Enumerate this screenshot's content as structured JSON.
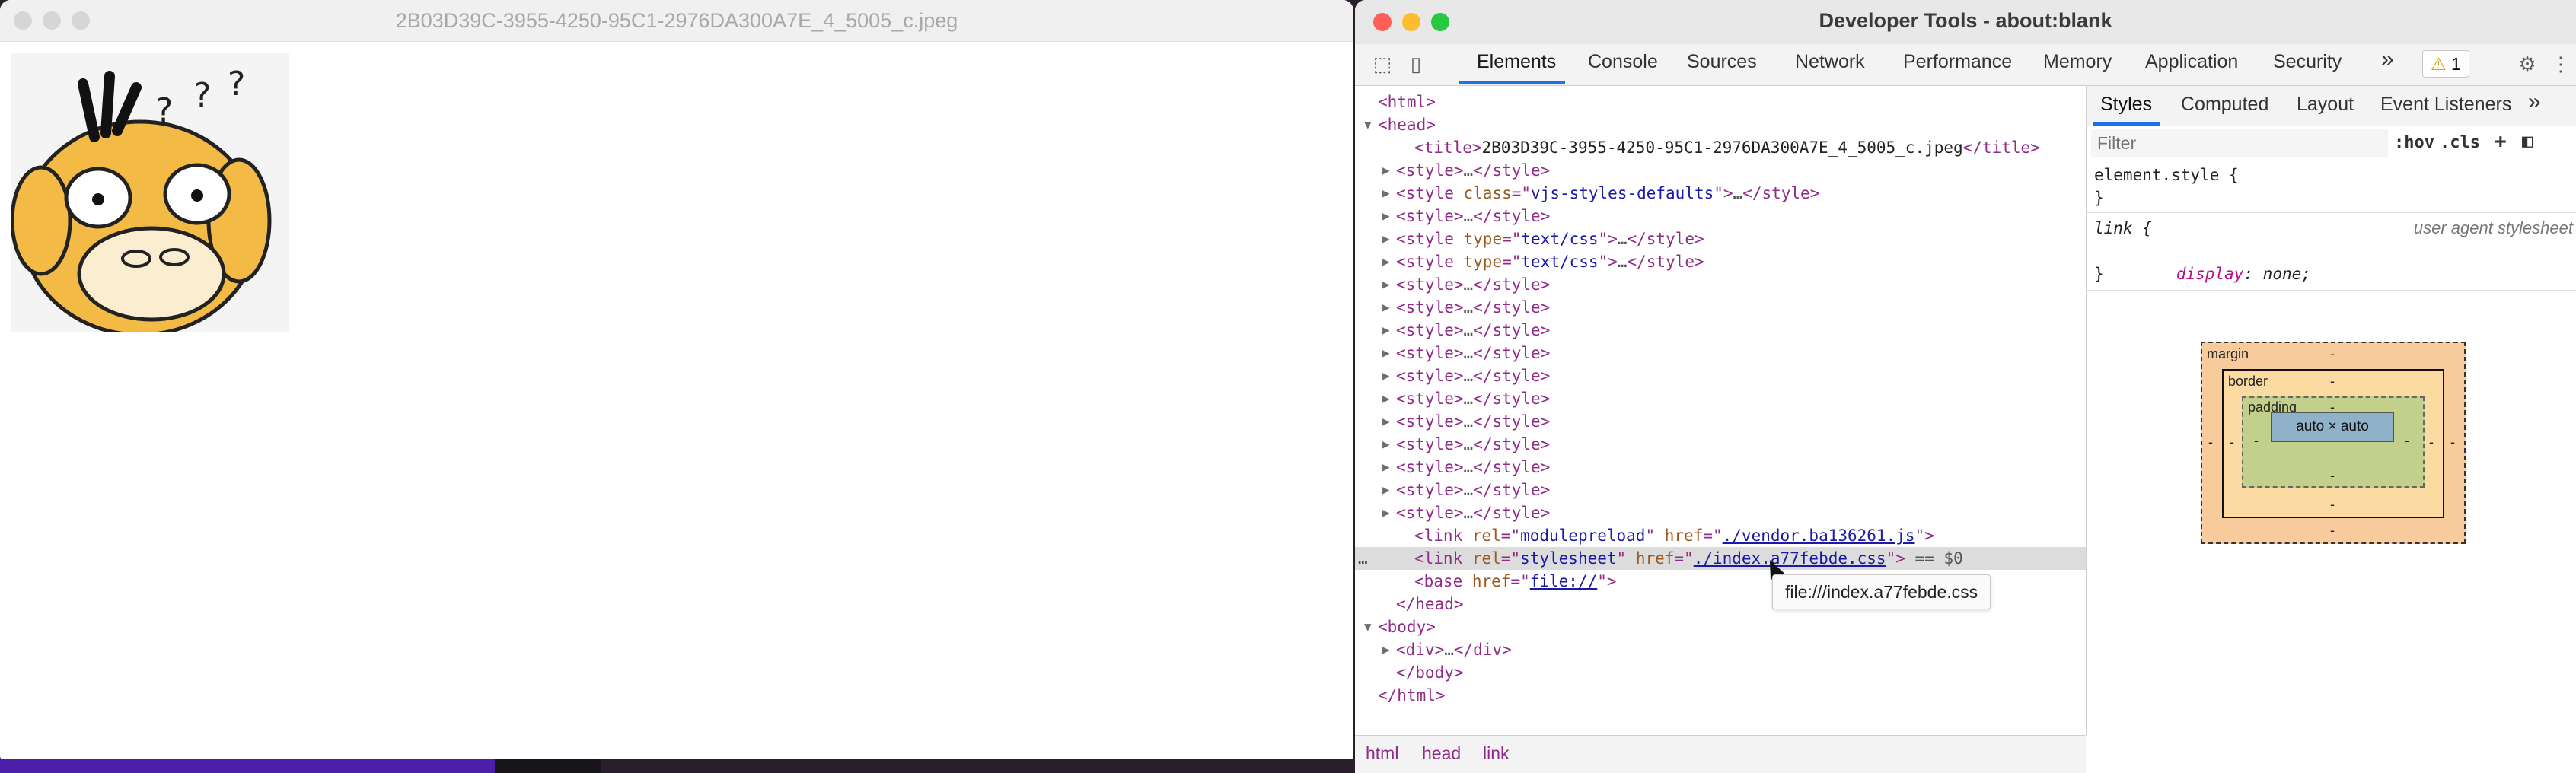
{
  "image_window": {
    "title": "2B03D39C-3955-4250-95C1-2976DA300A7E_4_5005_c.jpeg"
  },
  "devtools": {
    "window_title": "Developer Tools - about:blank",
    "tabs": [
      "Elements",
      "Console",
      "Sources",
      "Network",
      "Performance",
      "Memory",
      "Application",
      "Security"
    ],
    "more_tabs": "»",
    "warning_count": "1",
    "dom": {
      "lines": [
        {
          "indent": 0,
          "tri": "",
          "parts": [
            [
              "tag",
              "<html>"
            ]
          ]
        },
        {
          "indent": 0,
          "tri": "▼",
          "parts": [
            [
              "tag",
              "<head>"
            ]
          ]
        },
        {
          "indent": 2,
          "tri": "",
          "parts": [
            [
              "tag",
              "<title>"
            ],
            [
              "txt",
              "2B03D39C-3955-4250-95C1-2976DA300A7E_4_5005_c.jpeg"
            ],
            [
              "tag",
              "</title>"
            ]
          ]
        },
        {
          "indent": 1,
          "tri": "▶",
          "parts": [
            [
              "tag",
              "<style>"
            ],
            [
              "ell",
              "…"
            ],
            [
              "tag",
              "</style>"
            ]
          ]
        },
        {
          "indent": 1,
          "tri": "▶",
          "parts": [
            [
              "tag",
              "<style "
            ],
            [
              "attr",
              "class"
            ],
            [
              "tag",
              "=\""
            ],
            [
              "val",
              "vjs-styles-defaults"
            ],
            [
              "tag",
              "\">"
            ],
            [
              "ell",
              "…"
            ],
            [
              "tag",
              "</style>"
            ]
          ]
        },
        {
          "indent": 1,
          "tri": "▶",
          "parts": [
            [
              "tag",
              "<style>"
            ],
            [
              "ell",
              "…"
            ],
            [
              "tag",
              "</style>"
            ]
          ]
        },
        {
          "indent": 1,
          "tri": "▶",
          "parts": [
            [
              "tag",
              "<style "
            ],
            [
              "attr",
              "type"
            ],
            [
              "tag",
              "=\""
            ],
            [
              "val",
              "text/css"
            ],
            [
              "tag",
              "\">"
            ],
            [
              "ell",
              "…"
            ],
            [
              "tag",
              "</style>"
            ]
          ]
        },
        {
          "indent": 1,
          "tri": "▶",
          "parts": [
            [
              "tag",
              "<style "
            ],
            [
              "attr",
              "type"
            ],
            [
              "tag",
              "=\""
            ],
            [
              "val",
              "text/css"
            ],
            [
              "tag",
              "\">"
            ],
            [
              "ell",
              "…"
            ],
            [
              "tag",
              "</style>"
            ]
          ]
        },
        {
          "indent": 1,
          "tri": "▶",
          "parts": [
            [
              "tag",
              "<style>"
            ],
            [
              "ell",
              "…"
            ],
            [
              "tag",
              "</style>"
            ]
          ]
        },
        {
          "indent": 1,
          "tri": "▶",
          "parts": [
            [
              "tag",
              "<style>"
            ],
            [
              "ell",
              "…"
            ],
            [
              "tag",
              "</style>"
            ]
          ]
        },
        {
          "indent": 1,
          "tri": "▶",
          "parts": [
            [
              "tag",
              "<style>"
            ],
            [
              "ell",
              "…"
            ],
            [
              "tag",
              "</style>"
            ]
          ]
        },
        {
          "indent": 1,
          "tri": "▶",
          "parts": [
            [
              "tag",
              "<style>"
            ],
            [
              "ell",
              "…"
            ],
            [
              "tag",
              "</style>"
            ]
          ]
        },
        {
          "indent": 1,
          "tri": "▶",
          "parts": [
            [
              "tag",
              "<style>"
            ],
            [
              "ell",
              "…"
            ],
            [
              "tag",
              "</style>"
            ]
          ]
        },
        {
          "indent": 1,
          "tri": "▶",
          "parts": [
            [
              "tag",
              "<style>"
            ],
            [
              "ell",
              "…"
            ],
            [
              "tag",
              "</style>"
            ]
          ]
        },
        {
          "indent": 1,
          "tri": "▶",
          "parts": [
            [
              "tag",
              "<style>"
            ],
            [
              "ell",
              "…"
            ],
            [
              "tag",
              "</style>"
            ]
          ]
        },
        {
          "indent": 1,
          "tri": "▶",
          "parts": [
            [
              "tag",
              "<style>"
            ],
            [
              "ell",
              "…"
            ],
            [
              "tag",
              "</style>"
            ]
          ]
        },
        {
          "indent": 1,
          "tri": "▶",
          "parts": [
            [
              "tag",
              "<style>"
            ],
            [
              "ell",
              "…"
            ],
            [
              "tag",
              "</style>"
            ]
          ]
        },
        {
          "indent": 1,
          "tri": "▶",
          "parts": [
            [
              "tag",
              "<style>"
            ],
            [
              "ell",
              "…"
            ],
            [
              "tag",
              "</style>"
            ]
          ]
        },
        {
          "indent": 1,
          "tri": "▶",
          "parts": [
            [
              "tag",
              "<style>"
            ],
            [
              "ell",
              "…"
            ],
            [
              "tag",
              "</style>"
            ]
          ]
        },
        {
          "indent": 2,
          "tri": "",
          "parts": [
            [
              "tag",
              "<link "
            ],
            [
              "attr",
              "rel"
            ],
            [
              "tag",
              "=\""
            ],
            [
              "val",
              "modulepreload"
            ],
            [
              "tag",
              "\" "
            ],
            [
              "attr",
              "href"
            ],
            [
              "tag",
              "=\""
            ],
            [
              "link",
              "./vendor.ba136261.js"
            ],
            [
              "tag",
              "\">"
            ]
          ]
        },
        {
          "indent": 2,
          "tri": "",
          "selected": true,
          "parts": [
            [
              "tag",
              "<link "
            ],
            [
              "attr",
              "rel"
            ],
            [
              "tag",
              "=\""
            ],
            [
              "val",
              "stylesheet"
            ],
            [
              "tag",
              "\" "
            ],
            [
              "attr",
              "href"
            ],
            [
              "tag",
              "=\""
            ],
            [
              "link",
              "./index.a77febde.css"
            ],
            [
              "tag",
              "\">"
            ],
            [
              "ell",
              " == $0"
            ]
          ]
        },
        {
          "indent": 2,
          "tri": "",
          "parts": [
            [
              "tag",
              "<base "
            ],
            [
              "attr",
              "href"
            ],
            [
              "tag",
              "=\""
            ],
            [
              "link",
              "file://"
            ],
            [
              "tag",
              "\">"
            ]
          ]
        },
        {
          "indent": 1,
          "tri": "",
          "parts": [
            [
              "tag",
              "</head>"
            ]
          ]
        },
        {
          "indent": 0,
          "tri": "▼",
          "parts": [
            [
              "tag",
              "<body>"
            ]
          ]
        },
        {
          "indent": 1,
          "tri": "▶",
          "parts": [
            [
              "tag",
              "<div>"
            ],
            [
              "ell",
              "…"
            ],
            [
              "tag",
              "</div>"
            ]
          ]
        },
        {
          "indent": 1,
          "tri": "",
          "parts": [
            [
              "tag",
              "</body>"
            ]
          ]
        },
        {
          "indent": 0,
          "tri": "",
          "parts": [
            [
              "tag",
              "</html>"
            ]
          ]
        }
      ],
      "selected_dots": "…",
      "tooltip": "file:///index.a77febde.css"
    },
    "breadcrumbs": [
      "html",
      "head",
      "link"
    ],
    "styles_panel": {
      "tabs": [
        "Styles",
        "Computed",
        "Layout",
        "Event Listeners"
      ],
      "more": "»",
      "filter_placeholder": "Filter",
      "hov": ":hov",
      "cls": ".cls",
      "element_style_open": "element.style {",
      "close_brace": "}",
      "rule_selector": "link {",
      "rule_source": "user agent stylesheet",
      "rule_prop": "display",
      "rule_val": "none;",
      "box_model": {
        "margin_label": "margin",
        "border_label": "border",
        "padding_label": "padding",
        "content": "auto × auto",
        "dash": "-"
      }
    }
  },
  "colors": {
    "accent": "#1a73e8",
    "traffic_red": "#fe5f57",
    "traffic_yellow": "#febc2e",
    "traffic_green": "#28c840",
    "traffic_inactive": "#d0d0d0"
  }
}
